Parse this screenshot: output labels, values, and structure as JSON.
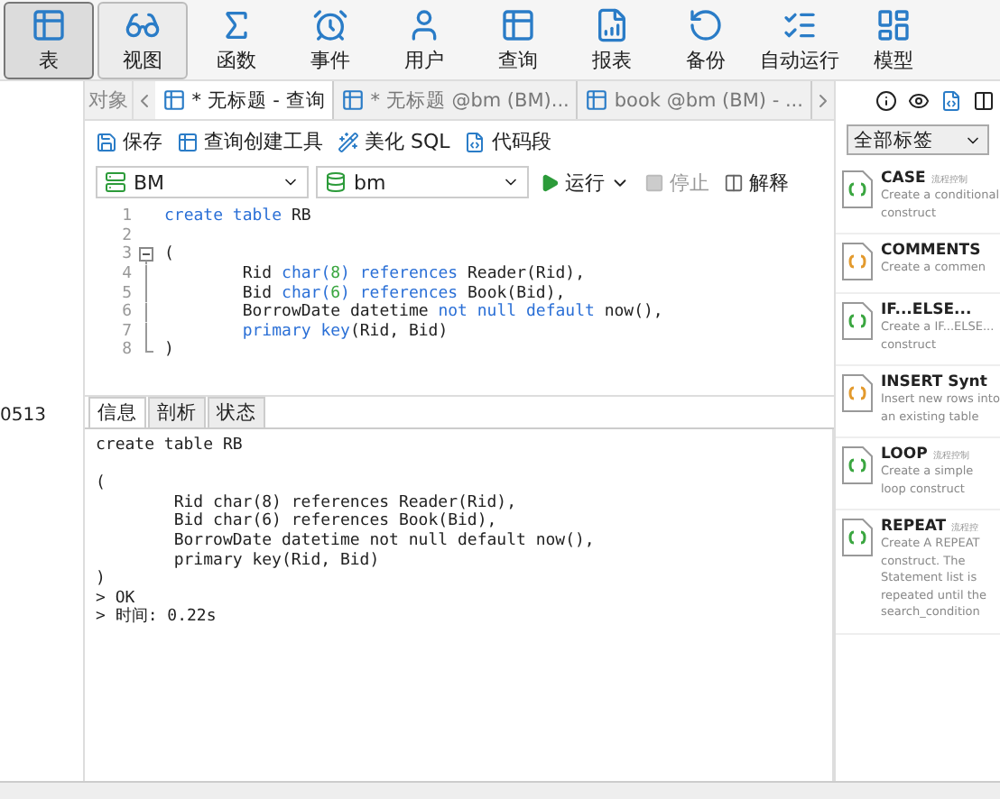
{
  "toolbar": [
    {
      "label": "表",
      "selected": true,
      "hovered": false
    },
    {
      "label": "视图",
      "selected": false,
      "hovered": true
    },
    {
      "label": "函数",
      "selected": false,
      "hovered": false
    },
    {
      "label": "事件",
      "selected": false,
      "hovered": false
    },
    {
      "label": "用户",
      "selected": false,
      "hovered": false
    },
    {
      "label": "查询",
      "selected": false,
      "hovered": false
    },
    {
      "label": "报表",
      "selected": false,
      "hovered": false
    },
    {
      "label": "备份",
      "selected": false,
      "hovered": false
    },
    {
      "label": "自动运行",
      "selected": false,
      "hovered": false
    },
    {
      "label": "模型",
      "selected": false,
      "hovered": false
    }
  ],
  "sidebar": {
    "items": [
      {
        "label": "0513"
      }
    ]
  },
  "tabs": {
    "objects_label": "对象",
    "items": [
      {
        "label": "* 无标题 - 查询",
        "selected": true
      },
      {
        "label": "* 无标题 @bm (BM)...",
        "selected": false
      },
      {
        "label": "book @bm (BM) - ...",
        "selected": false
      }
    ]
  },
  "editor_toolbar": [
    {
      "label": "保存"
    },
    {
      "label": "查询创建工具"
    },
    {
      "label": "美化 SQL"
    },
    {
      "label": "代码段"
    }
  ],
  "connection": {
    "server": "BM",
    "database": "bm",
    "run": "运行",
    "stop": "停止",
    "stop_disabled": true,
    "explain": "解释"
  },
  "code_lines": [
    {
      "number": "1",
      "fold_start": false,
      "in_fold": false,
      "tokens": [
        {
          "text": "create table",
          "kind": "kw"
        },
        {
          "text": " RB",
          "kind": "plain"
        }
      ]
    },
    {
      "number": "2",
      "fold_start": false,
      "in_fold": false
    },
    {
      "number": "3",
      "fold_start": true,
      "in_fold": false,
      "tokens": [
        {
          "text": "(",
          "kind": "plain"
        }
      ]
    },
    {
      "number": "4",
      "fold_start": false,
      "in_fold": true,
      "tokens": [
        {
          "text": "        Rid ",
          "kind": "plain"
        },
        {
          "text": "char(",
          "kind": "kw"
        },
        {
          "text": "8",
          "kind": "num"
        },
        {
          "text": ") references",
          "kind": "kw"
        },
        {
          "text": " Reader(Rid),",
          "kind": "plain"
        }
      ]
    },
    {
      "number": "5",
      "fold_start": false,
      "in_fold": true,
      "tokens": [
        {
          "text": "        Bid ",
          "kind": "plain"
        },
        {
          "text": "char(",
          "kind": "kw"
        },
        {
          "text": "6",
          "kind": "num"
        },
        {
          "text": ") references",
          "kind": "kw"
        },
        {
          "text": " Book(Bid),",
          "kind": "plain"
        }
      ]
    },
    {
      "number": "6",
      "fold_start": false,
      "in_fold": true,
      "tokens": [
        {
          "text": "        BorrowDate datetime ",
          "kind": "plain"
        },
        {
          "text": "not null default",
          "kind": "kw"
        },
        {
          "text": " now(),",
          "kind": "plain"
        }
      ]
    },
    {
      "number": "7",
      "fold_start": false,
      "in_fold": true,
      "tokens": [
        {
          "text": "        primary key",
          "kind": "kw"
        },
        {
          "text": "(Rid, Bid)",
          "kind": "plain"
        }
      ]
    },
    {
      "number": "8",
      "fold_start": false,
      "in_fold": true,
      "tokens": [
        {
          "text": ")",
          "kind": "plain"
        }
      ]
    }
  ],
  "result_tabs": [
    {
      "label": "信息",
      "selected": true
    },
    {
      "label": "剖析",
      "selected": false
    },
    {
      "label": "状态",
      "selected": false
    }
  ],
  "output_text": "create table RB\n\n(\n        Rid char(8) references Reader(Rid),\n        Bid char(6) references Book(Bid),\n        BorrowDate datetime not null default now(),\n        primary key(Rid, Bid)\n)\n> OK\n> 时间: 0.22s",
  "snippets": {
    "filter": "全部标签",
    "items": [
      {
        "title": "CASE",
        "tag": "流程控制",
        "description": "Create a conditional construct",
        "color": "#3aa640"
      },
      {
        "title": "COMMENTS",
        "description": "Create a commen",
        "color": "#e39a2d"
      },
      {
        "title": "IF...ELSE...",
        "description": "Create a IF...ELSE... construct",
        "color": "#3aa640"
      },
      {
        "title": "INSERT Synt",
        "description": "Insert new rows into an existing table",
        "color": "#e39a2d"
      },
      {
        "title": "LOOP",
        "tag": "流程控制",
        "description": "Create a simple loop construct",
        "color": "#3aa640"
      },
      {
        "title": "REPEAT",
        "tag": "流程控",
        "description": "Create A REPEAT construct. The Statement list is repeated until the search_condition",
        "color": "#3aa640"
      }
    ]
  }
}
